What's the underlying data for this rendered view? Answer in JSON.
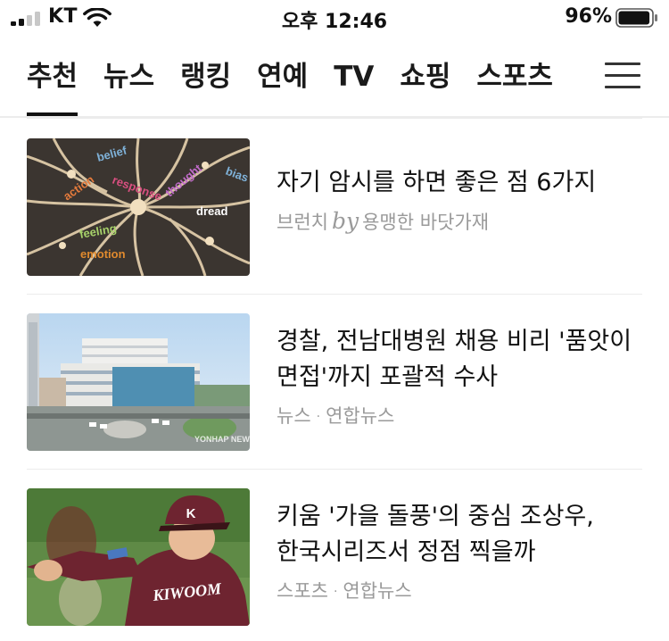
{
  "status_bar": {
    "carrier": "KT",
    "time": "오후 12:46",
    "battery_percent": "96%",
    "battery_level": 0.96,
    "signal_bars": 2,
    "signal_icon": "cellular-signal-icon",
    "wifi_icon": "wifi-icon",
    "battery_icon": "battery-icon"
  },
  "nav": {
    "tabs": [
      {
        "label": "추천",
        "active": true
      },
      {
        "label": "뉴스",
        "active": false
      },
      {
        "label": "랭킹",
        "active": false
      },
      {
        "label": "연예",
        "active": false
      },
      {
        "label": "TV",
        "active": false
      },
      {
        "label": "쇼핑",
        "active": false
      },
      {
        "label": "스포츠",
        "active": false
      }
    ],
    "menu_icon": "hamburger-menu-icon"
  },
  "articles": [
    {
      "headline": "자기 암시를 하면 좋은 점 6가지",
      "category": "브런치",
      "by": "by",
      "author": "용맹한 바닷가재",
      "thumb_words": [
        "belief",
        "response",
        "action",
        "feeling",
        "emotion",
        "dread",
        "bias",
        "thought"
      ]
    },
    {
      "headline": "경찰, 전남대병원 채용 비리 '품앗이 면접'까지 포괄적 수사",
      "category": "뉴스",
      "separator": "·",
      "source": "연합뉴스",
      "thumb_watermark": "YONHAP NEWS"
    },
    {
      "headline": "키움 '가을 돌풍'의 중심 조상우, 한국시리즈서 정점 찍을까",
      "category": "스포츠",
      "separator": "·",
      "source": "연합뉴스",
      "thumb_jersey_text": "KIWOOM",
      "thumb_cap_letter": "K"
    }
  ]
}
